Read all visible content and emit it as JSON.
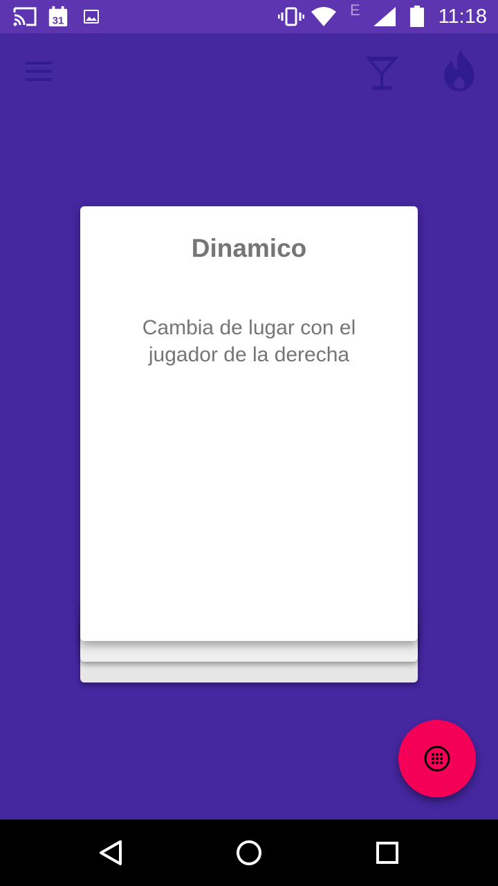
{
  "status_bar": {
    "time": "11:18",
    "calendar_day": "31",
    "network_type": "E",
    "icons": [
      "cast-icon",
      "calendar-icon",
      "image-icon",
      "vibrate-icon",
      "wifi-icon",
      "signal-icon",
      "battery-icon"
    ]
  },
  "app_bar": {
    "icons": [
      "menu-icon",
      "cocktail-icon",
      "fire-icon"
    ],
    "icon_color": "#311B92"
  },
  "card": {
    "title": "Dinamico",
    "text": "Cambia de lugar con el jugador de la derecha"
  },
  "fab": {
    "icon": "dice-icon",
    "color": "#F50057"
  },
  "colors": {
    "background": "#4527A0",
    "status_bar": "#5E35B1"
  },
  "nav_bar": {
    "icons": [
      "back-icon",
      "home-icon",
      "recents-icon"
    ]
  }
}
